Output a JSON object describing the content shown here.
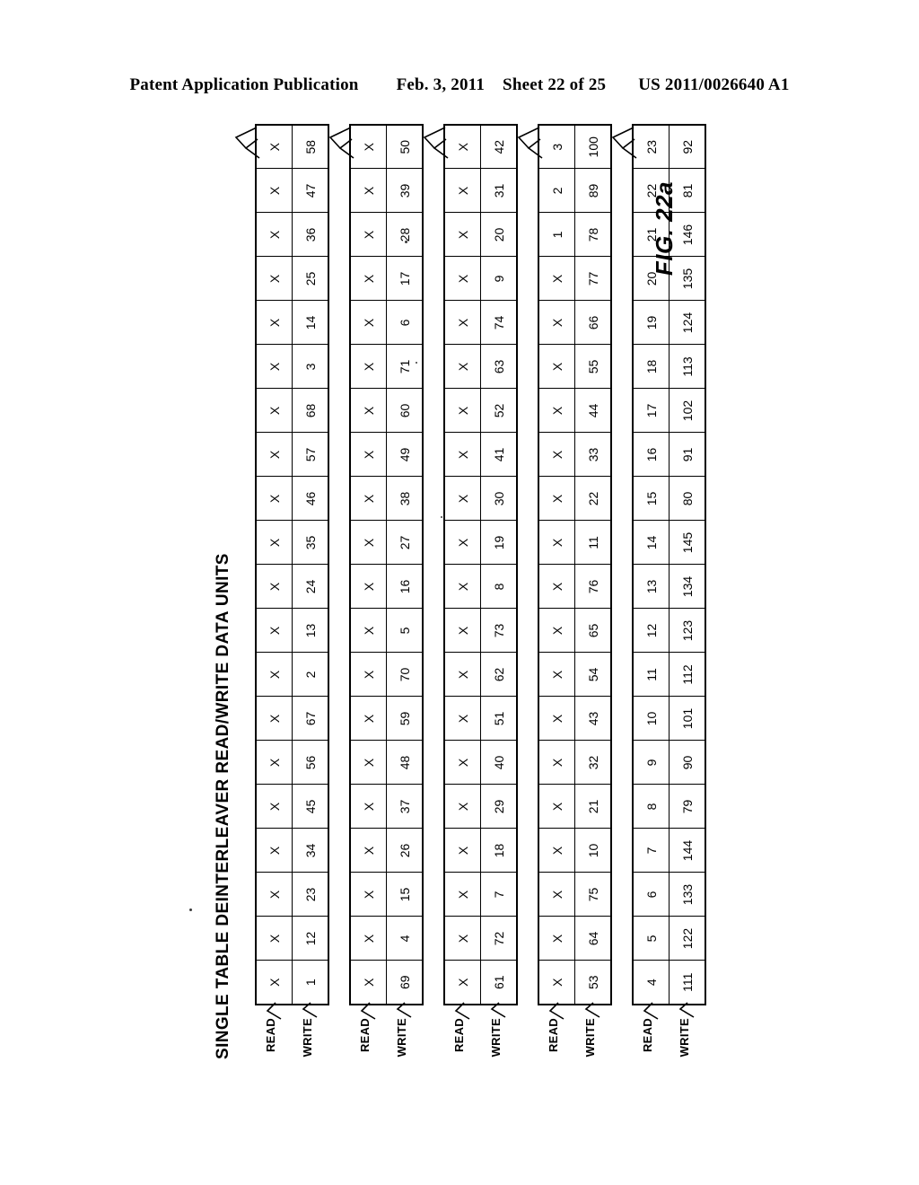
{
  "header": {
    "publication": "Patent Application Publication",
    "date": "Feb. 3, 2011",
    "sheet": "Sheet 22 of 25",
    "number": "US 2011/0026640 A1"
  },
  "figure": {
    "title": "SINGLE TABLE DEINTERLEAVER READ/WRITE DATA UNITS",
    "label": "FIG. 22a",
    "read_label": "READ",
    "write_label": "WRITE",
    "empty_marker": "X"
  },
  "chart_data": {
    "type": "table",
    "title": "SINGLE TABLE DEINTERLEAVER READ/WRITE DATA UNITS",
    "row_headers": [
      "READ",
      "WRITE"
    ],
    "groups": [
      {
        "index": 1,
        "read": [
          "X",
          "X",
          "X",
          "X",
          "X",
          "X",
          "X",
          "X",
          "X",
          "X",
          "X",
          "X",
          "X",
          "X",
          "X",
          "X",
          "X",
          "X",
          "X",
          "X"
        ],
        "write": [
          "1",
          "12",
          "23",
          "34",
          "45",
          "56",
          "67",
          "2",
          "13",
          "24",
          "35",
          "46",
          "57",
          "68",
          "3",
          "14",
          "25",
          "36",
          "47",
          "58"
        ]
      },
      {
        "index": 2,
        "read": [
          "X",
          "X",
          "X",
          "X",
          "X",
          "X",
          "X",
          "X",
          "X",
          "X",
          "X",
          "X",
          "X",
          "X",
          "X",
          "X",
          "X",
          "X",
          "X",
          "X"
        ],
        "write": [
          "69",
          "4",
          "15",
          "26",
          "37",
          "48",
          "59",
          "70",
          "5",
          "16",
          "27",
          "38",
          "49",
          "60",
          "71",
          "6",
          "17",
          "28",
          "39",
          "50"
        ]
      },
      {
        "index": 3,
        "read": [
          "X",
          "X",
          "X",
          "X",
          "X",
          "X",
          "X",
          "X",
          "X",
          "X",
          "X",
          "X",
          "X",
          "X",
          "X",
          "X",
          "X",
          "X",
          "X",
          "X"
        ],
        "write": [
          "61",
          "72",
          "7",
          "18",
          "29",
          "40",
          "51",
          "62",
          "73",
          "8",
          "19",
          "30",
          "41",
          "52",
          "63",
          "74",
          "9",
          "20",
          "31",
          "42"
        ]
      },
      {
        "index": 4,
        "read": [
          "X",
          "X",
          "X",
          "X",
          "X",
          "X",
          "X",
          "X",
          "X",
          "X",
          "X",
          "X",
          "X",
          "X",
          "X",
          "X",
          "X",
          "1",
          "2",
          "3"
        ],
        "write": [
          "53",
          "64",
          "75",
          "10",
          "21",
          "32",
          "43",
          "54",
          "65",
          "76",
          "11",
          "22",
          "33",
          "44",
          "55",
          "66",
          "77",
          "78",
          "89",
          "100"
        ]
      },
      {
        "index": 5,
        "read": [
          "4",
          "5",
          "6",
          "7",
          "8",
          "9",
          "10",
          "11",
          "12",
          "13",
          "14",
          "15",
          "16",
          "17",
          "18",
          "19",
          "20",
          "21",
          "22",
          "23"
        ],
        "write": [
          "111",
          "122",
          "133",
          "144",
          "79",
          "90",
          "101",
          "112",
          "123",
          "134",
          "145",
          "80",
          "91",
          "102",
          "113",
          "124",
          "135",
          "146",
          "81",
          "92"
        ]
      }
    ]
  }
}
